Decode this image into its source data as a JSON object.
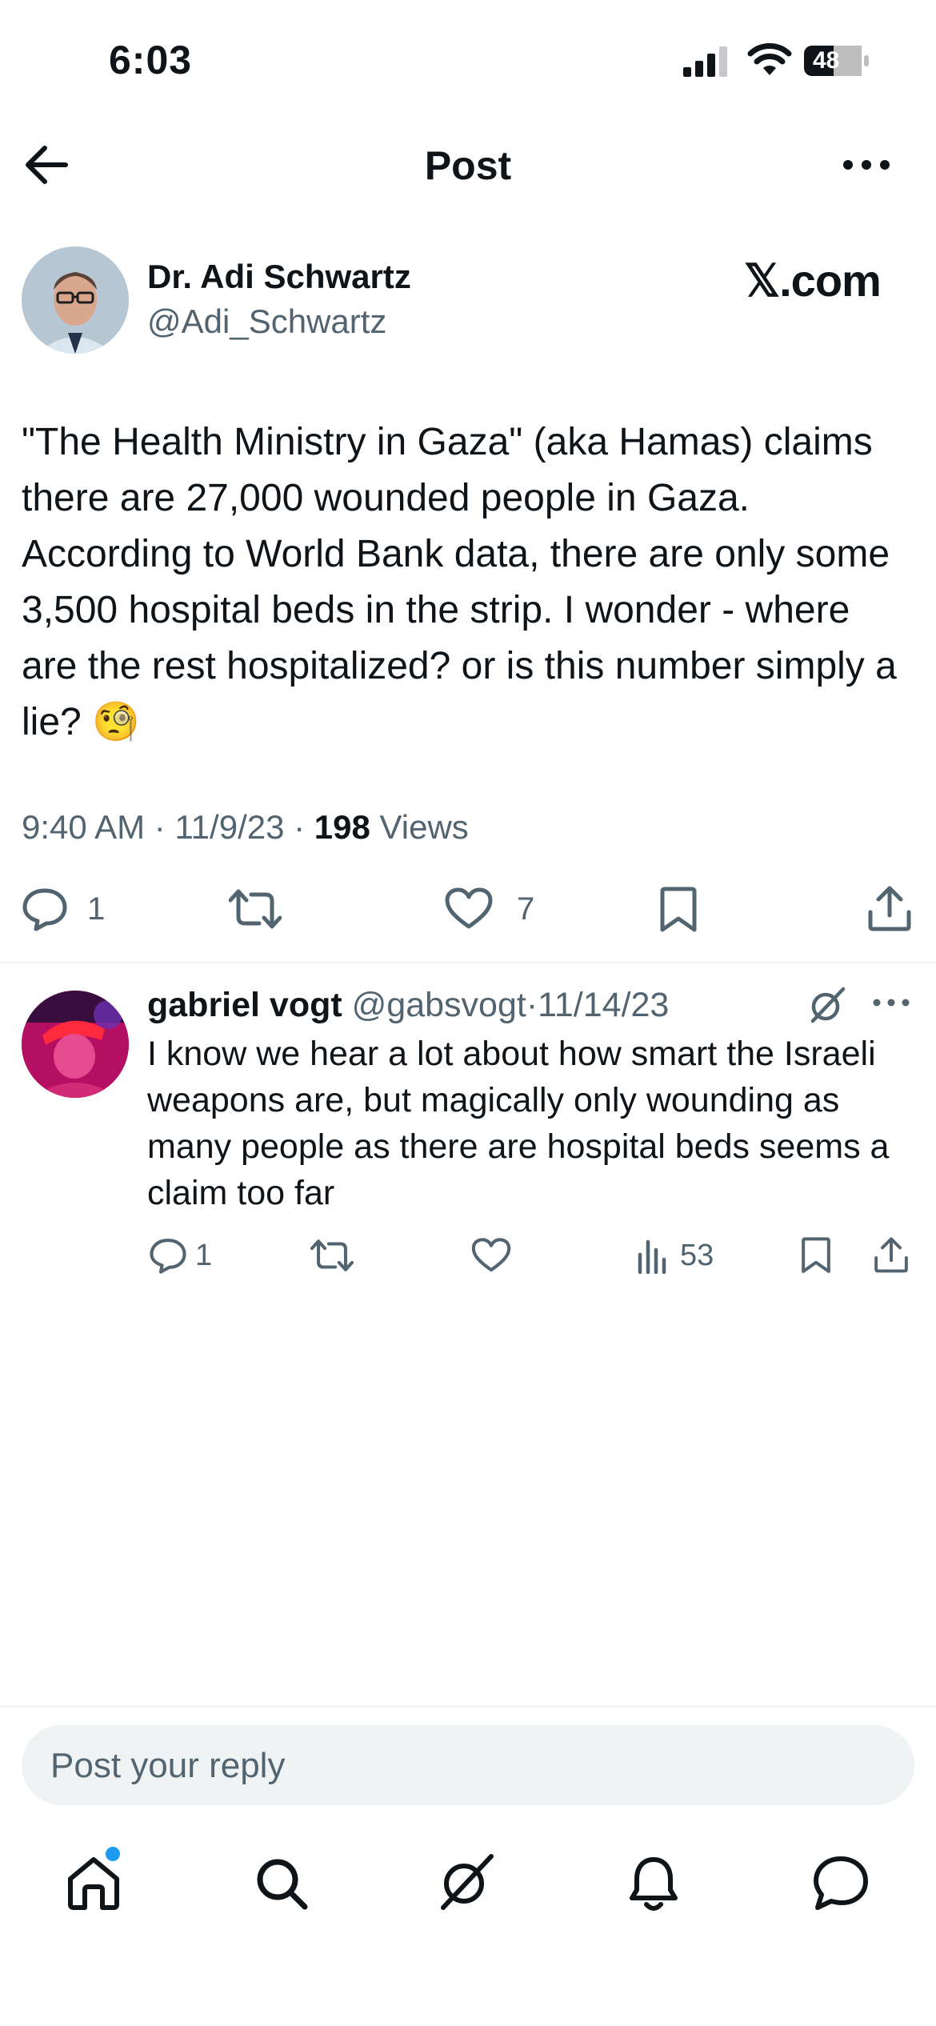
{
  "status_bar": {
    "time": "6:03",
    "battery": "48"
  },
  "header": {
    "title": "Post",
    "back_icon": "arrow-left-icon",
    "more_icon": "more-horizontal-icon"
  },
  "post": {
    "author_name": "Dr. Adi Schwartz",
    "author_handle": "@Adi_Schwartz",
    "source_label": "𝕏.com",
    "text": "\"The Health Ministry in Gaza\" (aka Hamas) claims there are 27,000 wounded people in Gaza. According to World Bank data, there are only some 3,500 hospital beds in the strip. I wonder - where are the rest hospitalized? or is this number simply a lie? 🧐",
    "time": "9:40 AM",
    "date": "11/9/23",
    "views_count": "198",
    "views_label": "Views",
    "actions": {
      "reply_count": "1",
      "like_count": "7"
    }
  },
  "reply": {
    "name": "gabriel vogt",
    "handle": "@gabsvogt",
    "separator": "·",
    "date": "11/14/23",
    "text": "I know we hear a lot about how smart the Israeli weapons are, but magically only wounding as many people as there are hospital beds seems a claim too far",
    "reply_count": "1",
    "views_count": "53"
  },
  "composer": {
    "placeholder": "Post your reply"
  },
  "tab_bar": {
    "items": [
      "home-icon",
      "search-icon",
      "grok-icon",
      "notifications-icon",
      "messages-icon"
    ],
    "home_has_dot": true,
    "dot_color": "#1d9bf0"
  },
  "colors": {
    "text": "#0f1419",
    "muted": "#536471",
    "accent": "#1d9bf0",
    "divider": "#eff3f4"
  }
}
